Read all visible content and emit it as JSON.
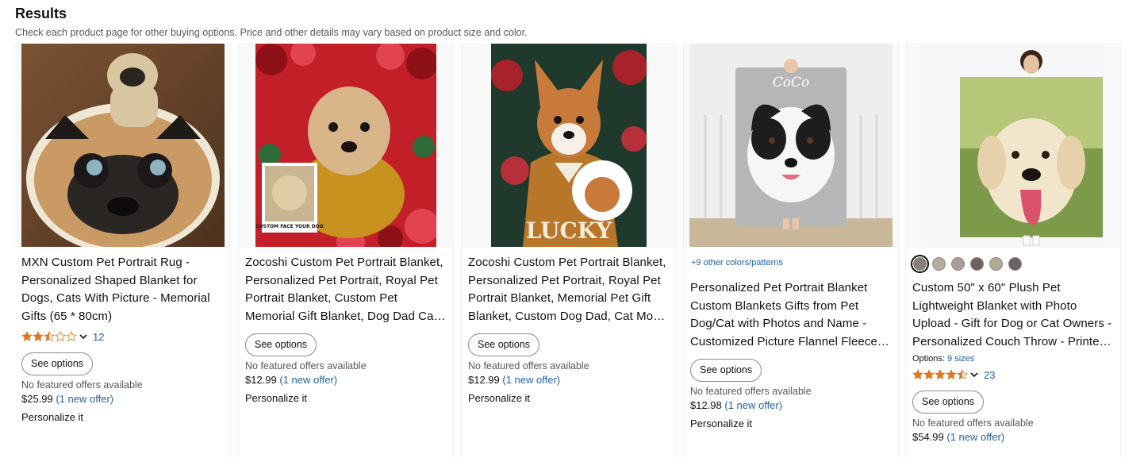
{
  "header": {
    "title": "Results",
    "subtitle": "Check each product page for other buying options. Price and other details may vary based on product size and color."
  },
  "products": [
    {
      "title": "MXN Custom Pet Portrait Rug - Personalized Shaped Blanket for Dogs, Cats With Picture - Memorial Gifts (65 * 80cm)",
      "rating": 2.5,
      "rating_count": "12",
      "see_options": "See options",
      "no_offers": "No featured offers available",
      "price": "$25.99",
      "offer": "(1 new offer)",
      "personalize": "Personalize it"
    },
    {
      "title": "Zocoshi Custom Pet Portrait Blanket, Personalized Pet Portrait, Royal Pet Portrait Blanket, Custom Pet Memorial Gift Blanket, Dog Dad Cat Mom Gifts",
      "see_options": "See options",
      "no_offers": "No featured offers available",
      "price": "$12.99",
      "offer": "(1 new offer)",
      "personalize": "Personalize it",
      "image_caption": "CUSTOM FACE YOUR DOG"
    },
    {
      "title": "Zocoshi Custom Pet Portrait Blanket, Personalized Pet Portrait, Royal Pet Portrait Blanket, Memorial Pet Gift Blanket, Custom Dog Dad, Cat Mom Gifts",
      "see_options": "See options",
      "no_offers": "No featured offers available",
      "price": "$12.99",
      "offer": "(1 new offer)",
      "personalize": "Personalize it",
      "image_caption": "LUCKY"
    },
    {
      "more_colors": "+9 other colors/patterns",
      "title": "Personalized Pet Portrait Blanket Custom Blankets Gifts from Pet Dog/Cat with Photos and Name - Customized Picture Flannel Fleece Throw",
      "see_options": "See options",
      "no_offers": "No featured offers available",
      "price": "$12.98",
      "offer": "(1 new offer)",
      "personalize": "Personalize it",
      "image_caption": "CoCo"
    },
    {
      "swatches": [
        "#8a7f76",
        "#b7ab9d",
        "#a89e94",
        "#6e625a",
        "#b3a894",
        "#6a625c"
      ],
      "title": "Custom 50\" x 60\" Plush Pet Lightweight Blanket with Photo Upload - Gift for Dog or Cat Owners - Personalized Couch Throw - Printed in USA",
      "options_label": "Options:",
      "options_value": "9 sizes",
      "rating": 4.5,
      "rating_count": "23",
      "see_options": "See options",
      "no_offers": "No featured offers available",
      "price": "$54.99",
      "offer": "(1 new offer)"
    }
  ],
  "colors": {
    "star": "#de7921",
    "link": "#2162a1",
    "text": "#0f1111",
    "muted": "#565959"
  }
}
